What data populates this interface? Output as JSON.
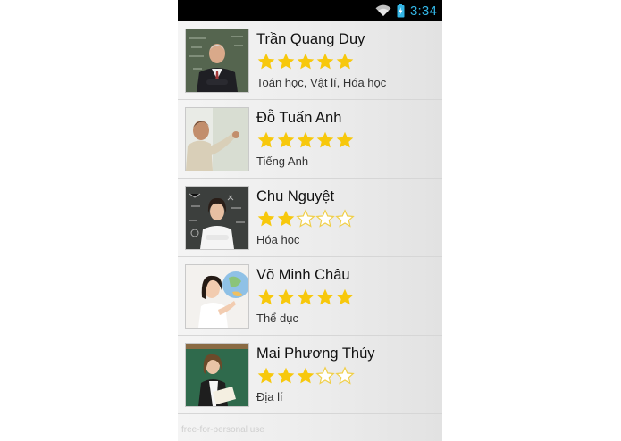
{
  "status_bar": {
    "time": "3:34",
    "time_color": "#33b5e5",
    "icons": [
      "wifi-icon",
      "battery-icon"
    ]
  },
  "colors": {
    "star_filled": "#f7c80c",
    "star_empty_stroke": "#f0cf4a",
    "spellcheck_underline": "#e03434"
  },
  "teachers": [
    {
      "name": "Trần Quang Duy",
      "rating": 5,
      "max_rating": 5,
      "subjects": "Toán học, Vật lí, Hóa học",
      "photo": "teacher-photo-man-chalkboard"
    },
    {
      "name": "Đỗ Tuấn Anh",
      "rating": 5,
      "max_rating": 5,
      "subjects": "Tiếng Anh",
      "photo": "teacher-photo-man-writing-board"
    },
    {
      "name": "Chu Nguyệt",
      "rating": 2,
      "max_rating": 5,
      "subjects": "Hóa học",
      "photo": "teacher-photo-woman-chemistry-board"
    },
    {
      "name": "Võ Minh Châu",
      "rating": 5,
      "max_rating": 5,
      "subjects": "Thể dục",
      "photo": "teacher-photo-woman-globe"
    },
    {
      "name": "Mai Phương Thúy",
      "rating": 3,
      "max_rating": 5,
      "subjects": "Địa lí",
      "photo": "teacher-photo-woman-book"
    }
  ],
  "watermark": "free-for-personal use"
}
